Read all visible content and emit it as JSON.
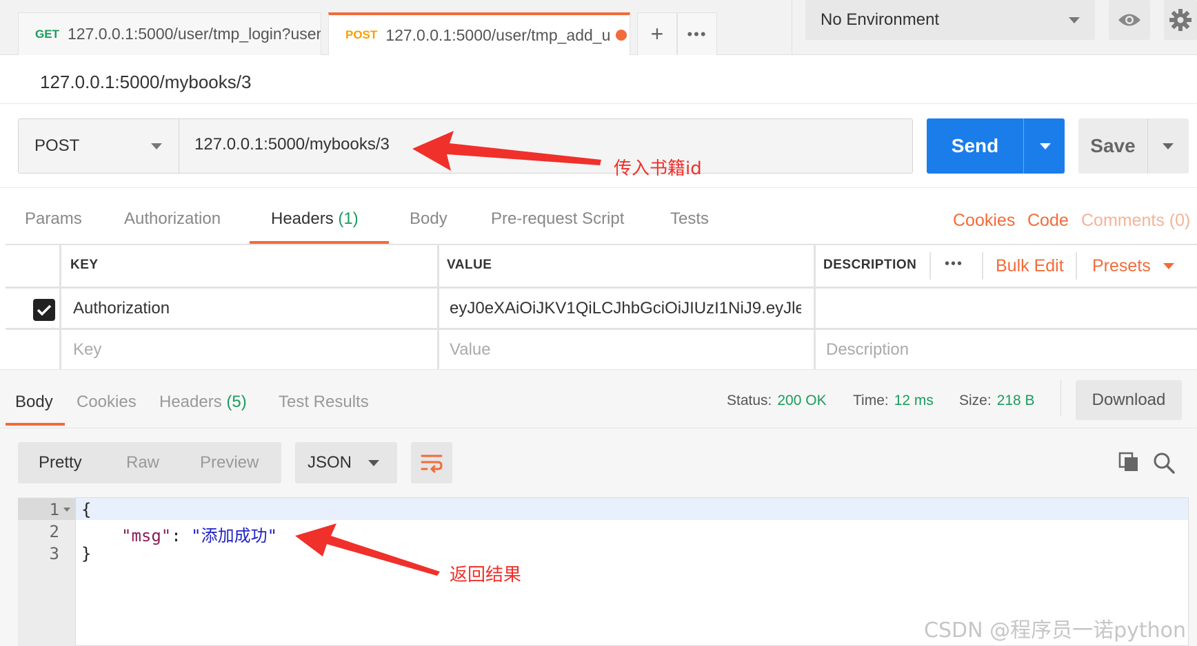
{
  "tabs": [
    {
      "method": "GET",
      "url": "127.0.0.1:5000/user/tmp_login?user"
    },
    {
      "method": "POST",
      "url": "127.0.0.1:5000/user/tmp_add_u"
    }
  ],
  "tab_actions": {
    "add": "+",
    "more": "•••"
  },
  "environment": {
    "selected": "No Environment"
  },
  "request_name": "127.0.0.1:5000/mybooks/3",
  "request": {
    "method": "POST",
    "url": "127.0.0.1:5000/mybooks/3",
    "send_label": "Send",
    "save_label": "Save"
  },
  "annotations": {
    "url": "传入书籍id",
    "result": "返回结果"
  },
  "request_tabs": [
    {
      "label": "Params"
    },
    {
      "label": "Authorization"
    },
    {
      "label": "Headers",
      "count": "(1)"
    },
    {
      "label": "Body"
    },
    {
      "label": "Pre-request Script"
    },
    {
      "label": "Tests"
    }
  ],
  "request_links": {
    "cookies": "Cookies",
    "code": "Code",
    "comments": "Comments (0)"
  },
  "headers_table": {
    "columns": {
      "key": "KEY",
      "value": "VALUE",
      "description": "DESCRIPTION"
    },
    "actions": {
      "more": "•••",
      "bulk_edit": "Bulk Edit",
      "presets": "Presets"
    },
    "rows": [
      {
        "checked": true,
        "key": "Authorization",
        "value": "eyJ0eXAiOiJKV1QiLCJhbGciOiJIUzI1NiJ9.eyJle...",
        "description": ""
      }
    ],
    "placeholders": {
      "key": "Key",
      "value": "Value",
      "description": "Description"
    }
  },
  "response_tabs": [
    {
      "label": "Body"
    },
    {
      "label": "Cookies"
    },
    {
      "label": "Headers",
      "count": "(5)"
    },
    {
      "label": "Test Results"
    }
  ],
  "response_status": {
    "status_label": "Status:",
    "status": "200 OK",
    "time_label": "Time:",
    "time": "12 ms",
    "size_label": "Size:",
    "size": "218 B"
  },
  "download_label": "Download",
  "view_modes": [
    "Pretty",
    "Raw",
    "Preview"
  ],
  "format": "JSON",
  "code": {
    "line_numbers": [
      "1",
      "2",
      "3"
    ],
    "open": "{",
    "key": "\"msg\"",
    "colon": ": ",
    "value": "\"添加成功\"",
    "close": "}"
  },
  "watermark": "CSDN @程序员一诺python",
  "colors": {
    "accent": "#f26b3a",
    "primary": "#1a7dea",
    "success": "#1a9c5c",
    "annotation": "#f0302a"
  }
}
